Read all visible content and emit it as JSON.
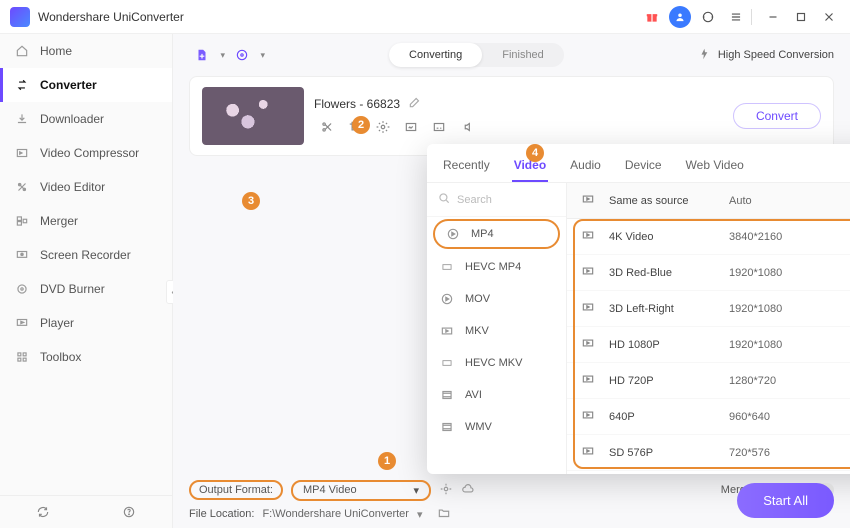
{
  "titlebar": {
    "title": "Wondershare UniConverter"
  },
  "sidebar": {
    "items": [
      {
        "label": "Home",
        "icon": "home"
      },
      {
        "label": "Converter",
        "icon": "converter",
        "active": true
      },
      {
        "label": "Downloader",
        "icon": "download"
      },
      {
        "label": "Video Compressor",
        "icon": "compressor"
      },
      {
        "label": "Video Editor",
        "icon": "editor"
      },
      {
        "label": "Merger",
        "icon": "merger"
      },
      {
        "label": "Screen Recorder",
        "icon": "recorder"
      },
      {
        "label": "DVD Burner",
        "icon": "burner"
      },
      {
        "label": "Player",
        "icon": "player"
      },
      {
        "label": "Toolbox",
        "icon": "toolbox"
      }
    ]
  },
  "toolbar": {
    "segment": {
      "converting": "Converting",
      "finished": "Finished"
    },
    "high_speed": "High Speed Conversion"
  },
  "card": {
    "name": "Flowers - 66823",
    "convert": "Convert"
  },
  "panel": {
    "tabs": {
      "recently": "Recently",
      "video": "Video",
      "audio": "Audio",
      "device": "Device",
      "web": "Web Video"
    },
    "search_placeholder": "Search",
    "formats": [
      "MP4",
      "HEVC MP4",
      "MOV",
      "MKV",
      "HEVC MKV",
      "AVI",
      "WMV"
    ],
    "resolutions": [
      {
        "name": "Same as source",
        "res": "Auto"
      },
      {
        "name": "4K Video",
        "res": "3840*2160"
      },
      {
        "name": "3D Red-Blue",
        "res": "1920*1080"
      },
      {
        "name": "3D Left-Right",
        "res": "1920*1080"
      },
      {
        "name": "HD 1080P",
        "res": "1920*1080"
      },
      {
        "name": "HD 720P",
        "res": "1280*720"
      },
      {
        "name": "640P",
        "res": "960*640"
      },
      {
        "name": "SD 576P",
        "res": "720*576"
      }
    ]
  },
  "bottom": {
    "output_format_label": "Output Format:",
    "output_format_value": "MP4 Video",
    "file_location_label": "File Location:",
    "file_location_value": "F:\\Wondershare UniConverter",
    "merge_label": "Merge All Files:",
    "start_all": "Start All"
  },
  "annotations": {
    "a1": "1",
    "a2": "2",
    "a3": "3",
    "a4": "4"
  }
}
